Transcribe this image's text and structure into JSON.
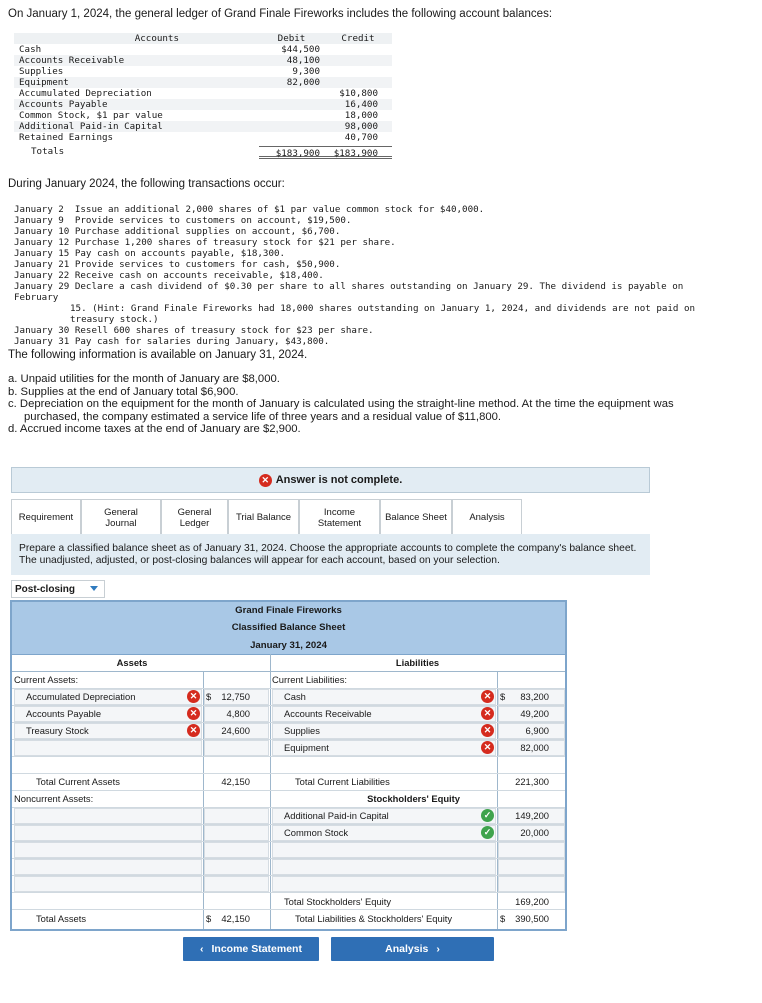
{
  "intro": "On January 1, 2024, the general ledger of Grand Finale Fireworks includes the following account balances:",
  "accounts": {
    "headers": [
      "Accounts",
      "Debit",
      "Credit"
    ],
    "rows": [
      [
        "Cash",
        "$44,500",
        ""
      ],
      [
        "Accounts Receivable",
        "48,100",
        ""
      ],
      [
        "Supplies",
        "9,300",
        ""
      ],
      [
        "Equipment",
        "82,000",
        ""
      ],
      [
        "Accumulated Depreciation",
        "",
        "$10,800"
      ],
      [
        "Accounts Payable",
        "",
        "16,400"
      ],
      [
        "Common Stock, $1 par value",
        "",
        "18,000"
      ],
      [
        "Additional Paid-in Capital",
        "",
        "98,000"
      ],
      [
        "Retained Earnings",
        "",
        "40,700"
      ]
    ],
    "totals": [
      "Totals",
      "$183,900",
      "$183,900"
    ]
  },
  "during": "During January 2024, the following transactions occur:",
  "transactions": [
    "January 2  Issue an additional 2,000 shares of $1 par value common stock for $40,000.",
    "January 9  Provide services to customers on account, $19,500.",
    "January 10 Purchase additional supplies on account, $6,700.",
    "January 12 Purchase 1,200 shares of treasury stock for $21 per share.",
    "January 15 Pay cash on accounts payable, $18,300.",
    "January 21 Provide services to customers for cash, $50,900.",
    "January 22 Receive cash on accounts receivable, $18,400.",
    "January 29 Declare a cash dividend of $0.30 per share to all shares outstanding on January 29. The dividend is payable on February",
    "15. (Hint: Grand Finale Fireworks had 18,000 shares outstanding on January 1, 2024, and dividends are not paid on",
    "treasury stock.)",
    "January 30 Resell 600 shares of treasury stock for $23 per share.",
    "January 31 Pay cash for salaries during January, $43,800."
  ],
  "following": "The following information is available on January 31, 2024.",
  "info_items": [
    "a. Unpaid utilities for the month of January are $8,000.",
    "b. Supplies at the end of January total $6,900.",
    "c. Depreciation on the equipment for the month of January is calculated using the straight-line method. At the time the equipment was",
    "purchased, the company estimated a service life of three years and a residual value of $11,800.",
    "d. Accrued income taxes at the end of January are $2,900."
  ],
  "banner": "Answer is not complete.",
  "tabs": [
    "Requirement",
    "General Journal",
    "General Ledger",
    "Trial Balance",
    "Income Statement",
    "Balance Sheet",
    "Analysis"
  ],
  "instructions": "Prepare a classified balance sheet as of January 31, 2024. Choose the appropriate accounts to complete the company's balance sheet. The unadjusted, adjusted, or post-closing balances will appear for each account, based on your selection.",
  "dropdown_value": "Post-closing",
  "balance_sheet": {
    "company": "Grand Finale Fireworks",
    "title": "Classified Balance Sheet",
    "date": "January 31, 2024",
    "assets_header": "Assets",
    "liabilities_header": "Liabilities",
    "current_assets_label": "Current Assets:",
    "current_assets": [
      {
        "name": "Accumulated Depreciation",
        "amount": "12,750",
        "dollar": "$",
        "status": "wrong"
      },
      {
        "name": "Accounts Payable",
        "amount": "4,800",
        "dollar": "",
        "status": "wrong"
      },
      {
        "name": "Treasury Stock",
        "amount": "24,600",
        "dollar": "",
        "status": "wrong"
      }
    ],
    "total_current_assets_label": "Total Current Assets",
    "total_current_assets": "42,150",
    "noncurrent_assets_label": "Noncurrent Assets:",
    "total_assets_label": "Total Assets",
    "total_assets_dollar": "$",
    "total_assets": "42,150",
    "current_liabilities_label": "Current Liabilities:",
    "current_liabilities": [
      {
        "name": "Cash",
        "amount": "83,200",
        "dollar": "$",
        "status": "wrong"
      },
      {
        "name": "Accounts Receivable",
        "amount": "49,200",
        "dollar": "",
        "status": "wrong"
      },
      {
        "name": "Supplies",
        "amount": "6,900",
        "dollar": "",
        "status": "wrong"
      },
      {
        "name": "Equipment",
        "amount": "82,000",
        "dollar": "",
        "status": "wrong"
      }
    ],
    "total_current_liabilities_label": "Total Current Liabilities",
    "total_current_liabilities": "221,300",
    "stockholders_equity_header": "Stockholders' Equity",
    "equity": [
      {
        "name": "Additional Paid-in Capital",
        "amount": "149,200",
        "status": "correct"
      },
      {
        "name": "Common Stock",
        "amount": "20,000",
        "status": "correct"
      }
    ],
    "total_equity_label": "Total Stockholders' Equity",
    "total_equity": "169,200",
    "total_le_label": "Total Liabilities & Stockholders' Equity",
    "total_le_dollar": "$",
    "total_le": "390,500"
  },
  "nav": {
    "prev_label": "Income Statement",
    "next_label": "Analysis"
  }
}
